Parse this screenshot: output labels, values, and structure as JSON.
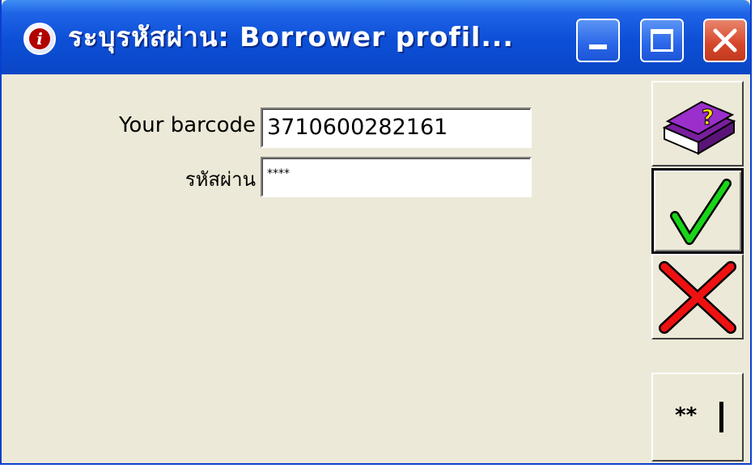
{
  "window": {
    "title": "ระบุรหัสผ่าน: Borrower profil...",
    "icon": "info-icon",
    "colors": {
      "titlebar": "#0a46c6",
      "face": "#ece9d8",
      "close": "#d6452a"
    }
  },
  "titlebar_buttons": {
    "minimize": "minimize-icon",
    "maximize": "maximize-icon",
    "close": "close-icon"
  },
  "form": {
    "barcode_label": "Your barcode",
    "barcode_value": "3710600282161",
    "password_label": "รหัสผ่าน",
    "password_value": "****"
  },
  "side_buttons": {
    "help": "help-book-icon",
    "ok": "checkmark-icon",
    "cancel": "cross-icon",
    "show_password": "password-mask-icon",
    "show_password_text": "**"
  }
}
